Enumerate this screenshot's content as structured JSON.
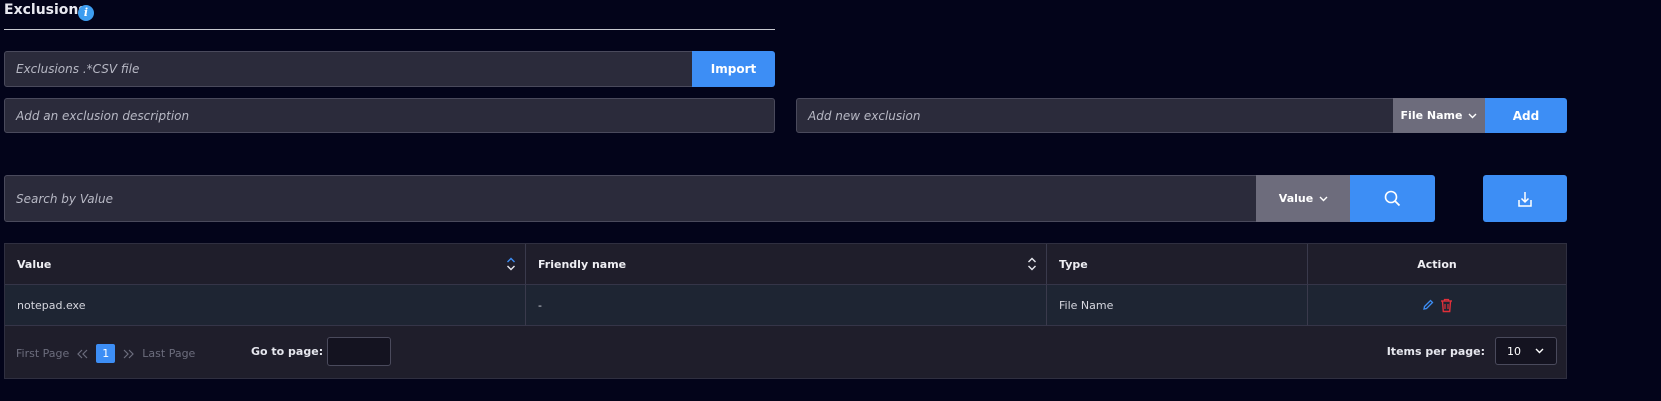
{
  "header": {
    "title": "Exclusions",
    "info_icon": "info-icon"
  },
  "import_section": {
    "file_placeholder": "Exclusions .*CSV file",
    "import_label": "Import"
  },
  "description": {
    "placeholder": "Add an exclusion description"
  },
  "new_exclusion": {
    "placeholder": "Add new exclusion",
    "type_selected": "File Name",
    "add_label": "Add"
  },
  "search": {
    "placeholder": "Search by Value",
    "field_selected": "Value",
    "search_icon": "search-icon",
    "download_icon": "download-icon"
  },
  "table": {
    "columns": [
      "Value",
      "Friendly name",
      "Type",
      "Action"
    ],
    "rows": [
      {
        "value": "notepad.exe",
        "friendly_name": "-",
        "type": "File Name"
      }
    ]
  },
  "pagination": {
    "first_label": "First Page",
    "last_label": "Last Page",
    "current_page": "1",
    "goto_label": "Go to page:",
    "items_per_page_label": "Items per page:",
    "items_per_page_value": "10"
  },
  "colors": {
    "accent": "#3d8ef5",
    "danger": "#e0303a",
    "background": "#03041a"
  }
}
